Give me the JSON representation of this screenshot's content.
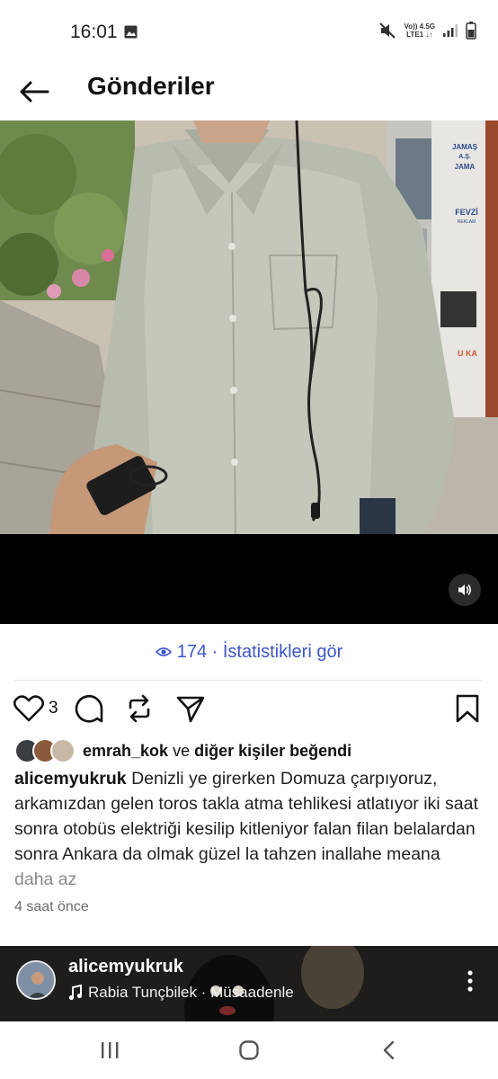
{
  "status_bar": {
    "time": "16:01",
    "network_top": "Vo)) 4.5G",
    "network_bottom": "LTE1 ↓↑",
    "icons": [
      "image-icon",
      "mute-icon",
      "signal-icon",
      "battery-icon"
    ]
  },
  "header": {
    "back_icon": "arrow-left-icon",
    "title": "Gönderiler"
  },
  "media": {
    "sign_top": "JAMAŞ",
    "sign_sub": "A.Ş.",
    "sign_sub2": "JAMA",
    "sign_brand": "FEVZİ",
    "sign_brand_sub": "REKLAM",
    "sign_bottom": "U KA",
    "sound_icon": "speaker-icon"
  },
  "insights": {
    "icon": "eye-icon",
    "text": "174 · İstatistikleri gör",
    "color": "#3d55c8"
  },
  "actions": {
    "like_count": "3",
    "icons": [
      "heart-icon",
      "comment-icon",
      "repost-icon",
      "share-icon",
      "bookmark-icon"
    ]
  },
  "likes": {
    "user": "emrah_kok",
    "connector": " ve ",
    "others": "diğer kişiler beğendi"
  },
  "caption": {
    "username": "alicemyukruk",
    "text": "Denizli ye girerken Domuza çarpıyoruz, arkamızdan gelen toros takla atma tehlikesi atlatıyor iki saat sonra otobüs elektriği kesilip kitleniyor falan filan belalardan sonra Ankara da olmak güzel la tahzen inallahe meana",
    "less": "daha az"
  },
  "time_ago": "4 saat önce",
  "next_post": {
    "username": "alicemyukruk",
    "music": "Rabia Tunçbilek · Müsaadenle",
    "music_icon": "music-note-icon",
    "more_icon": "more-vertical-icon"
  },
  "nav_bar": {
    "icons": [
      "recents-icon",
      "home-icon",
      "back-icon"
    ]
  }
}
